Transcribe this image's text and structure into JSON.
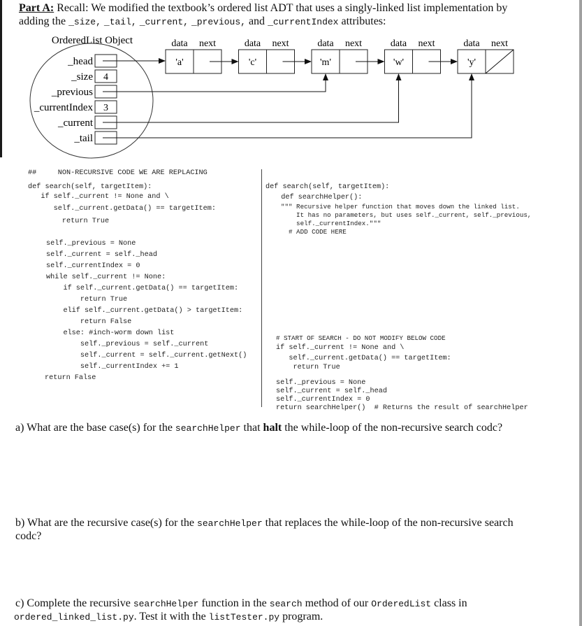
{
  "header": {
    "part_label": "Part A:",
    "line1_rest": " Recall:  We modified the textbook’s ordered list ADT that uses a singly-linked list implementation by",
    "line2_prefix": "adding the ",
    "attrs": [
      "_size,",
      "_tail,",
      "_current,",
      "_previous,"
    ],
    "and_word": "and",
    "last_attr": "_currentIndex",
    "line2_suffix": " attributes:"
  },
  "diagram": {
    "object_title": "OrderedList Object",
    "attributes": [
      {
        "name": "_head",
        "value": ""
      },
      {
        "name": "_size",
        "value": "4"
      },
      {
        "name": "_previous",
        "value": ""
      },
      {
        "name": "_currentIndex",
        "value": "3"
      },
      {
        "name": "_current",
        "value": ""
      },
      {
        "name": "_tail",
        "value": ""
      }
    ],
    "node_field_labels": {
      "data": "data",
      "next": "next"
    },
    "nodes": [
      "'a'",
      "'c'",
      "'m'",
      "'w'",
      "'y'"
    ],
    "pointers": {
      "_head": "'a'",
      "_previous": "'m'",
      "_current": "'w'",
      "_tail": "'y'"
    }
  },
  "left_code": {
    "header": "##     NON-RECURSIVE CODE WE ARE REPLACING",
    "lines": [
      "def search(self, targetItem):",
      "   if self._current != None and \\",
      "      self._current.getData() == targetItem:",
      "        return True",
      "self._previous = None",
      "self._current = self._head",
      "self._currentIndex = 0",
      "while self._current != None:",
      "    if self._current.getData() == targetItem:",
      "        return True",
      "    elif self._current.getData() > targetItem:",
      "        return False",
      "    else: #inch-worm down list",
      "        self._previous = self._current",
      "        self._current = self._current.getNext()",
      "        self._currentIndex += 1",
      "return False"
    ]
  },
  "right_code": {
    "lines_top": [
      "def search(self, targetItem):",
      "  def searchHelper():"
    ],
    "docstring": [
      "\"\"\" Recursive helper function that moves down the linked list.",
      "    It has no parameters, but uses self._current, self._previous,",
      "    self._currentIndex.\"\"\"",
      "  # ADD CODE HERE"
    ],
    "lines_bottom": [
      "# START OF SEARCH - DO NOT MODIFY BELOW CODE",
      "if self._current != None and \\",
      "   self._current.getData() == targetItem:",
      "    return True",
      "self._previous = None",
      "self._current = self._head",
      "self._currentIndex = 0",
      "return searchHelper()  # Returns the result of searchHelper"
    ]
  },
  "questions": {
    "a": {
      "prefix": "a)  What are the base case(s) for the ",
      "code": "searchHelper",
      "mid": " that ",
      "bold": "halt",
      "suffix": " the while-loop of the non-recursive search codc?"
    },
    "b": {
      "prefix": "b)  What are the recursive case(s) for the ",
      "code": "searchHelper",
      "suffix": " that replaces the while-loop of the non-recursive search",
      "line2": "codc?"
    },
    "c": {
      "prefix": "c)  Complete the recursive ",
      "code1": "searchHelper",
      "mid1": " function in the ",
      "code2": "search",
      "mid2": " method of our ",
      "code3": "OrderedList",
      "suffix": " class in",
      "line2_code1": "ordered_linked_list.py",
      "line2_mid": ".  Test it with the ",
      "line2_code2": "listTester.py",
      "line2_suffix": " program."
    }
  }
}
